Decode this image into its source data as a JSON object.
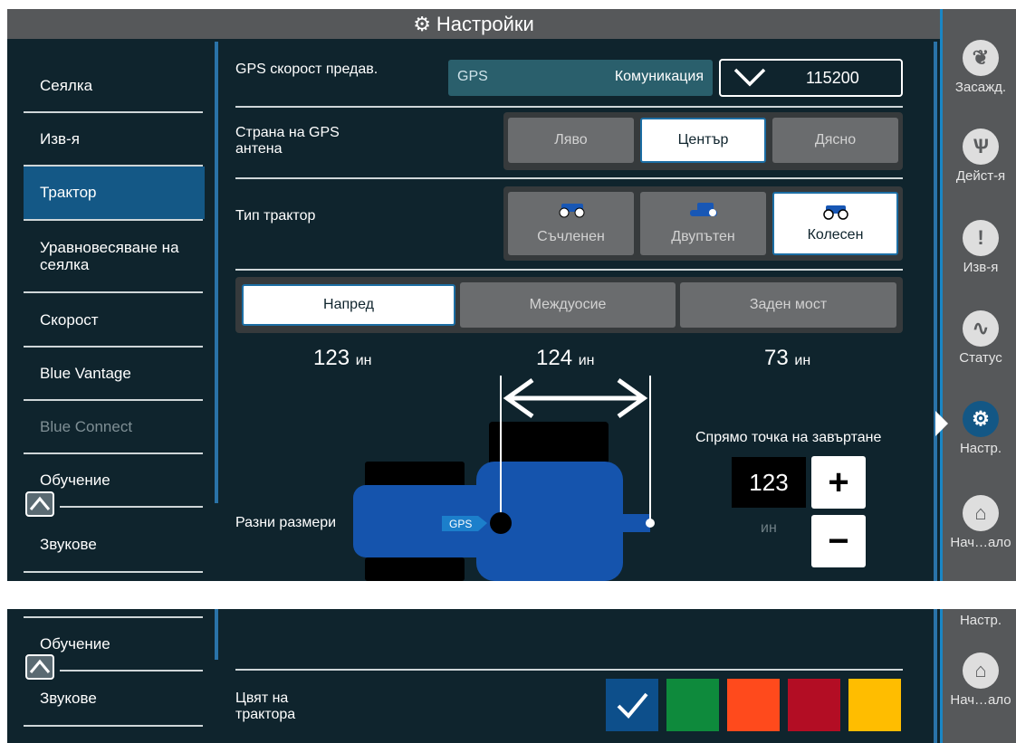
{
  "title": "Настройки",
  "sidebar": {
    "items": [
      {
        "label": "Сеялка"
      },
      {
        "label": "Изв-я"
      },
      {
        "label": "Трактор"
      },
      {
        "label": "Уравновесяване на сеялка"
      },
      {
        "label": "Скорост"
      },
      {
        "label": "Blue Vantage"
      },
      {
        "label": "Blue Connect"
      },
      {
        "label": "Обучение"
      },
      {
        "label": "Звукове"
      }
    ],
    "active": "Трактор"
  },
  "rail": {
    "items": [
      {
        "label": "Засажд.",
        "icon": "planting-icon"
      },
      {
        "label": "Дейст-я",
        "icon": "actions-icon"
      },
      {
        "label": "Изв-я",
        "icon": "alerts-shield-icon"
      },
      {
        "label": "Статус",
        "icon": "status-pulse-icon"
      },
      {
        "label": "Настр.",
        "icon": "settings-gear-icon"
      },
      {
        "label": "Нач…ало",
        "icon": "home-icon"
      }
    ],
    "active": "Настр."
  },
  "settings": {
    "gps_speed_label": "GPS скорост предав.",
    "gps_tag": "GPS",
    "communication_label": "Комуникация",
    "baud_value": "115200",
    "antenna_side_label": "Страна на GPS антена",
    "antenna_options": [
      "Ляво",
      "Център",
      "Дясно"
    ],
    "antenna_selected": "Център",
    "tractor_type_label": "Тип трактор",
    "tractor_options": [
      "Съчленен",
      "Двупътен",
      "Колесен"
    ],
    "tractor_selected": "Колесен",
    "axle_options": [
      "Напред",
      "Междуосие",
      "Заден мост"
    ],
    "axle_selected": "Напред",
    "measurements": [
      {
        "value": "123",
        "unit": "ин"
      },
      {
        "value": "124",
        "unit": "ин"
      },
      {
        "value": "73",
        "unit": "ин"
      }
    ],
    "misc_dims_label": "Разни размери",
    "gps_marker": "GPS",
    "pivot_label": "Спрямо точка на завъртане",
    "pivot_value": "123",
    "pivot_unit": "ин",
    "tractor_color_label": "Цвят на трактора",
    "colors": [
      "#0d4f8b",
      "#0e8a3c",
      "#ff4a1c",
      "#b30d24",
      "#ffbd00"
    ],
    "color_selected_index": 0
  },
  "bottom": {
    "sidebar_items": [
      "Обучение",
      "Звукове"
    ],
    "rail_items": [
      "Настр.",
      "Нач…ало"
    ]
  }
}
